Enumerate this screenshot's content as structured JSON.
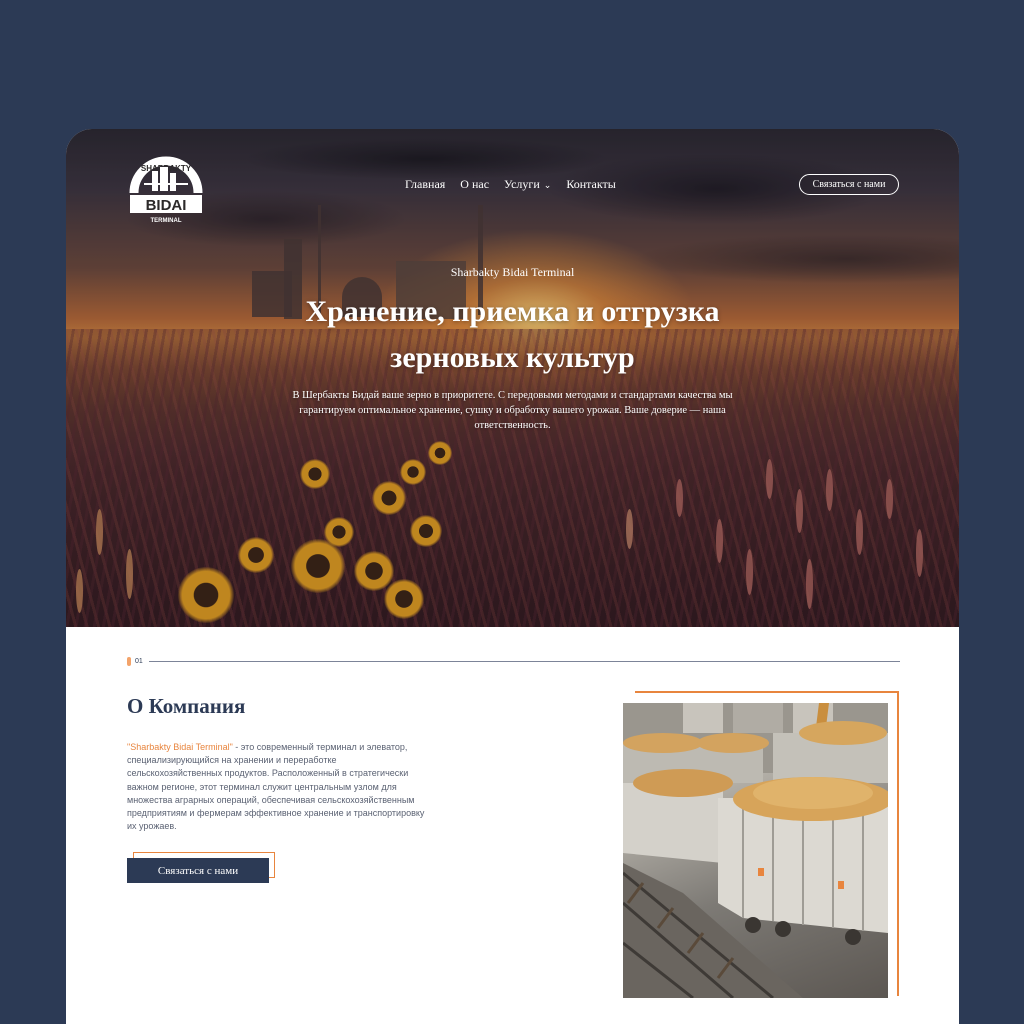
{
  "brand": {
    "logo_top": "SHARBAKTY",
    "logo_main": "BIDAI",
    "logo_bottom": "TERMINAL"
  },
  "nav": {
    "items": [
      {
        "label": "Главная"
      },
      {
        "label": "О нас"
      },
      {
        "label": "Услуги"
      },
      {
        "label": "Контакты"
      }
    ],
    "contact_button": "Связаться с нами"
  },
  "hero": {
    "subtitle": "Sharbakty Bidai Terminal",
    "title_line1": "Хранение, приемка и отгрузка",
    "title_line2": "зерновых культур",
    "description": "В Шербакты Бидай ваше зерно в приоритете. С передовыми методами и стандартами качества мы гарантируем оптимальное хранение, сушку и обработку вашего урожая. Ваше доверие — наша ответственность."
  },
  "about": {
    "section_number": "01",
    "title": "О Компания",
    "highlight": "\"Sharbakty Bidai Terminal\"",
    "text": " - это современный терминал и элеватор, специализирующийся на хранении и переработке сельскохозяйственных продуктов. Расположенный в стратегически важном регионе, этот терминал служит центральным узлом для множества аграрных операций, обеспечивая сельскохозяйственным предприятиям и фермерам эффективное хранение и транспортировку их урожаев.",
    "button": "Связаться с нами"
  },
  "colors": {
    "background": "#2c3a55",
    "accent": "#e8853e",
    "primary": "#2c3a55"
  }
}
